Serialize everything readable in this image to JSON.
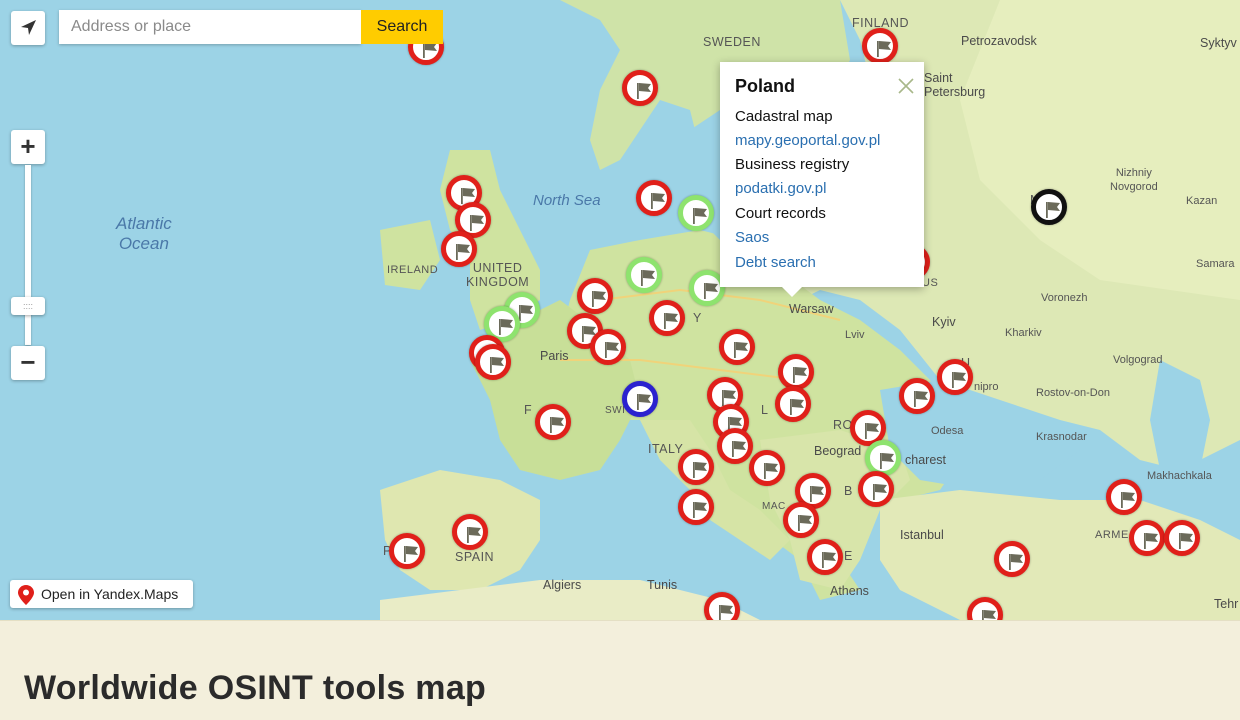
{
  "search": {
    "placeholder": "Address or place",
    "button_label": "Search"
  },
  "zoom": {
    "in_label": "+",
    "out_label": "−",
    "handle_label": "::::"
  },
  "yandex_link": "Open in Yandex.Maps",
  "popup": {
    "title": "Poland",
    "rows": [
      {
        "text": "Cadastral map",
        "link": false
      },
      {
        "text": "mapy.geoportal.gov.pl",
        "link": true
      },
      {
        "text": "Business registry",
        "link": false
      },
      {
        "text": "podatki.gov.pl",
        "link": true
      },
      {
        "text": "Court records",
        "link": false
      },
      {
        "text": "Saos",
        "link": true
      },
      {
        "text": "Debt search",
        "link": true
      }
    ]
  },
  "map_labels": {
    "sweden": "SWEDEN",
    "finland": "FINLAND",
    "petrozavodsk": "Petrozavodsk",
    "syktyvkar": "Syktyv",
    "saint_petersburg": "Saint\nPetersburg",
    "nizhniy": "Nizhniy\nNovgorod",
    "kazan": "Kazan",
    "samara": "Samara",
    "north_sea": "North Sea",
    "atlantic": "Atlantic\nOcean",
    "ireland": "IRELAND",
    "uk": "UNITED\nKINGDOM",
    "paris": "Paris",
    "warsaw": "Warsaw",
    "lviv": "Lviv",
    "kyiv": "Kyiv",
    "kharkiv": "Kharkiv",
    "voronezh": "Voronezh",
    "volgograd": "Volgograd",
    "rostov": "Rostov-on-Don",
    "krasnodar": "Krasnodar",
    "makhachkala": "Makhachkala",
    "dnipro": "nipro",
    "odesa": "Odesa",
    "bucharest": "charest",
    "belgrade": "Beograd",
    "italy": "ITALY",
    "spain": "SPAIN",
    "algiers": "Algiers",
    "tunis": "Tunis",
    "athens": "Athens",
    "istanbul": "Istanbul",
    "tehran": "Tehr",
    "armenia": "ARME",
    "france_fr": "F",
    "m_moscow": "M",
    "swiss": "SWI",
    "ro": "RO",
    "y_mark": "Y",
    "b_mark": "B",
    "mac": "MAC",
    "p_mark": "P",
    "l_mark": "L",
    "e_mark": "E",
    "ru_mark": "US"
  },
  "footer_title": "Worldwide OSINT tools map",
  "colors": {
    "red": "#e0201a",
    "green": "#8ee36e",
    "blue": "#2b22cf",
    "black": "#111111",
    "search_button": "#ffcc00",
    "link": "#2a6fb0"
  },
  "markers_icon": "flag-icon"
}
